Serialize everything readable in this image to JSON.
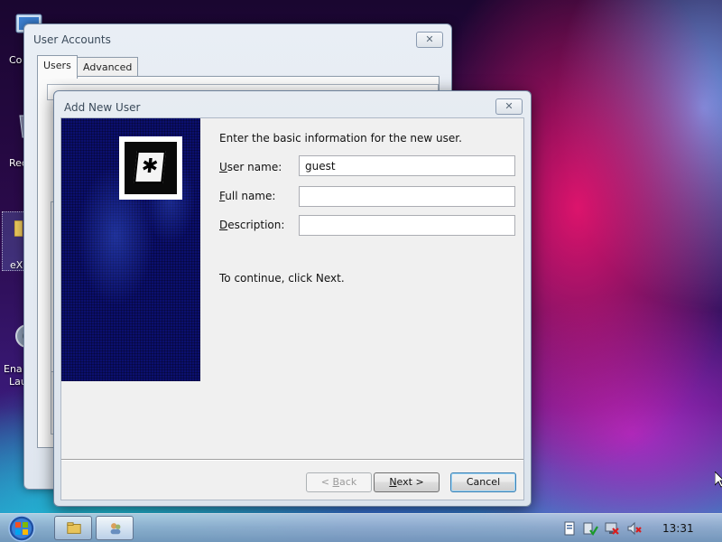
{
  "desktop": {
    "icons": [
      {
        "name": "computer",
        "label": "Co"
      },
      {
        "name": "recycle-bin",
        "label": "Rec"
      },
      {
        "name": "explorer-folder",
        "label": "eX"
      },
      {
        "name": "enable-launcher",
        "label_line1": "Ena",
        "label_line2": "Lau"
      }
    ]
  },
  "background_window": {
    "title": "User Accounts",
    "close_label": "✕",
    "tabs": [
      {
        "label": "Users",
        "active": true
      },
      {
        "label": "Advanced",
        "active": false
      }
    ]
  },
  "dialog": {
    "title": "Add New User",
    "close_label": "✕",
    "intro": "Enter the basic information for the new user.",
    "fields": [
      {
        "label_accel": "U",
        "label_rest": "ser name:",
        "value": "guest"
      },
      {
        "label_accel": "F",
        "label_rest": "ull name:",
        "value": ""
      },
      {
        "label_accel": "D",
        "label_rest": "escription:",
        "value": ""
      }
    ],
    "continue_text": "To continue, click Next.",
    "buttons": {
      "back_prefix": "< ",
      "back_accel": "B",
      "back_rest": "ack",
      "next_accel": "N",
      "next_rest": "ext >",
      "cancel": "Cancel"
    },
    "side_icon": "key-icon"
  },
  "taskbar": {
    "clock": "13:31",
    "items": [
      "start-orb",
      "explorer-taskbar-button",
      "user-accounts-taskbar-button"
    ],
    "tray": [
      "action-center-icon",
      "security-icon",
      "network-icon",
      "volume-muted-icon"
    ]
  },
  "colors": {
    "dialog_panel": "#0b0f6e",
    "default_button_border": "#3c7fb1"
  }
}
